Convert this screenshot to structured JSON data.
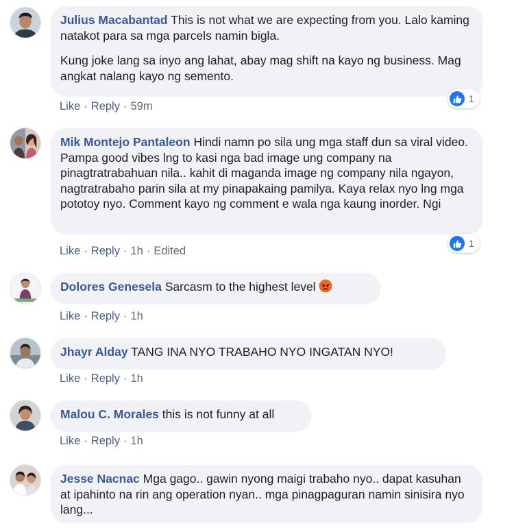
{
  "colors": {
    "bubble_bg": "#f0f2f5",
    "name": "#385898",
    "action_link": "#4a5d8f",
    "meta": "#606770",
    "like_blue": "#1877f2",
    "angry_orange": "#f06a22"
  },
  "actions": {
    "like": "Like",
    "reply": "Reply",
    "dot": "·"
  },
  "comments": [
    {
      "author": "Julius Macabantad",
      "paragraphs": [
        "This is not what we are expecting from you. Lalo kaming natakot para sa mga parcels namin bigla.",
        "Kung joke lang sa inyo ang lahat, abay mag shift na kayo ng business. Mag angkat nalang kayo ng semento."
      ],
      "time": "59m",
      "reaction_icon": "like-icon",
      "reaction_count": "1"
    },
    {
      "author": "Mik Montejo Pantaleon",
      "paragraphs": [
        "Hindi namn po sila ung mga staff dun sa viral video. Pampa good vibes lng to kasi nga bad image ung company na pinagtratrabahuan nila.. kahit di maganda image ng company nila ngayon, nagtratrabaho parin sila at my pinapakaing pamilya. Kaya relax nyo lng mga pototoy nyo. Comment kayo ng comment e wala nga kaung inorder. Ngi"
      ],
      "time": "1h",
      "edited": "Edited",
      "reaction_icon": "like-icon",
      "reaction_count": "1"
    },
    {
      "author": "Dolores Genesela",
      "paragraphs": [
        "Sarcasm to the highest level"
      ],
      "emoji": "angry-emoji-icon",
      "time": "1h"
    },
    {
      "author": "Jhayr Alday",
      "paragraphs": [
        "TANG INA NYO TRABAHO NYO INGATAN NYO!"
      ],
      "time": "1h"
    },
    {
      "author": "Malou C. Morales",
      "paragraphs": [
        "this is not funny at all"
      ],
      "time": "1h"
    },
    {
      "author": "Jesse Nacnac",
      "paragraphs": [
        "Mga gago.. gawin nyong maigi trabaho nyo.. dapat kasuhan at ipahinto na rin ang operation nyan.. mga pinagpaguran namin sinisira nyo lang..."
      ]
    }
  ]
}
